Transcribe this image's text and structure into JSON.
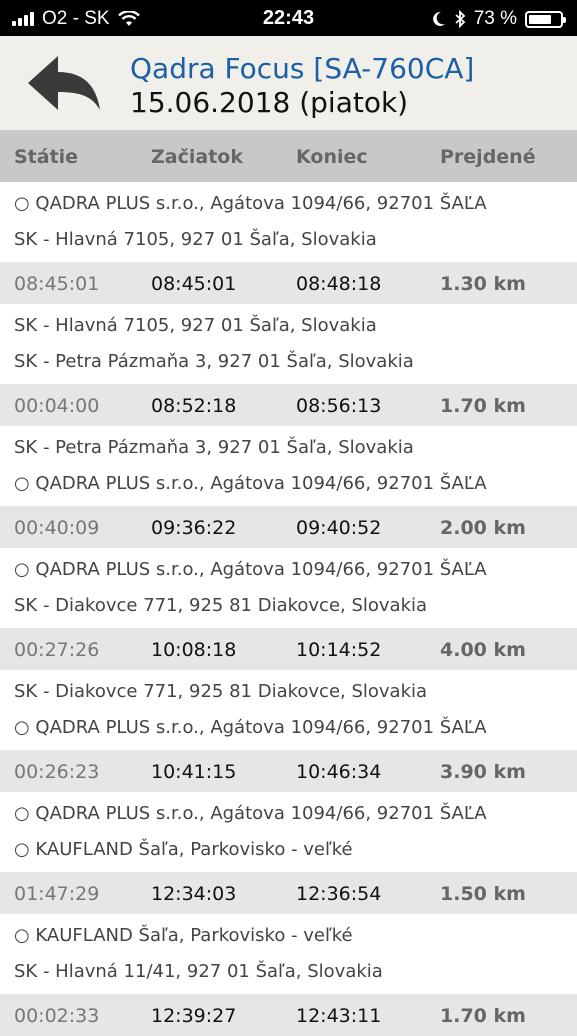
{
  "status_bar": {
    "carrier": "O2 - SK",
    "time": "22:43",
    "battery_percent": "73 %",
    "battery_level": 0.73
  },
  "header": {
    "title": "Qadra Focus [SA-760CA]",
    "subtitle": "15.06.2018 (piatok)"
  },
  "columns": [
    "Státie",
    "Začiatok",
    "Koniec",
    "Prejdené"
  ],
  "trips": [
    {
      "from": "○ QADRA PLUS s.r.o., Agátova 1094/66, 92701 ŠAĽA",
      "to": "SK - Hlavná 7105, 927 01 Šaľa, Slovakia",
      "stop": "08:45:01",
      "start": "08:45:01",
      "end": "08:48:18",
      "distance": "1.30 km"
    },
    {
      "from": "SK - Hlavná 7105, 927 01 Šaľa, Slovakia",
      "to": "SK - Petra Pázmaňa 3, 927 01 Šaľa, Slovakia",
      "stop": "00:04:00",
      "start": "08:52:18",
      "end": "08:56:13",
      "distance": "1.70 km"
    },
    {
      "from": "SK - Petra Pázmaňa 3, 927 01 Šaľa, Slovakia",
      "to": "○ QADRA PLUS s.r.o., Agátova 1094/66, 92701 ŠAĽA",
      "stop": "00:40:09",
      "start": "09:36:22",
      "end": "09:40:52",
      "distance": "2.00 km"
    },
    {
      "from": "○ QADRA PLUS s.r.o., Agátova 1094/66, 92701 ŠAĽA",
      "to": "SK - Diakovce 771, 925 81 Diakovce, Slovakia",
      "stop": "00:27:26",
      "start": "10:08:18",
      "end": "10:14:52",
      "distance": "4.00 km"
    },
    {
      "from": "SK - Diakovce 771, 925 81 Diakovce, Slovakia",
      "to": "○ QADRA PLUS s.r.o., Agátova 1094/66, 92701 ŠAĽA",
      "stop": "00:26:23",
      "start": "10:41:15",
      "end": "10:46:34",
      "distance": "3.90 km"
    },
    {
      "from": "○ QADRA PLUS s.r.o., Agátova 1094/66, 92701 ŠAĽA",
      "to": "○ KAUFLAND Šaľa, Parkovisko - veľké",
      "stop": "01:47:29",
      "start": "12:34:03",
      "end": "12:36:54",
      "distance": "1.50 km"
    },
    {
      "from": "○ KAUFLAND Šaľa, Parkovisko - veľké",
      "to": "SK - Hlavná 11/41, 927 01 Šaľa, Slovakia",
      "stop": "00:02:33",
      "start": "12:39:27",
      "end": "12:43:11",
      "distance": "1.70 km"
    }
  ]
}
